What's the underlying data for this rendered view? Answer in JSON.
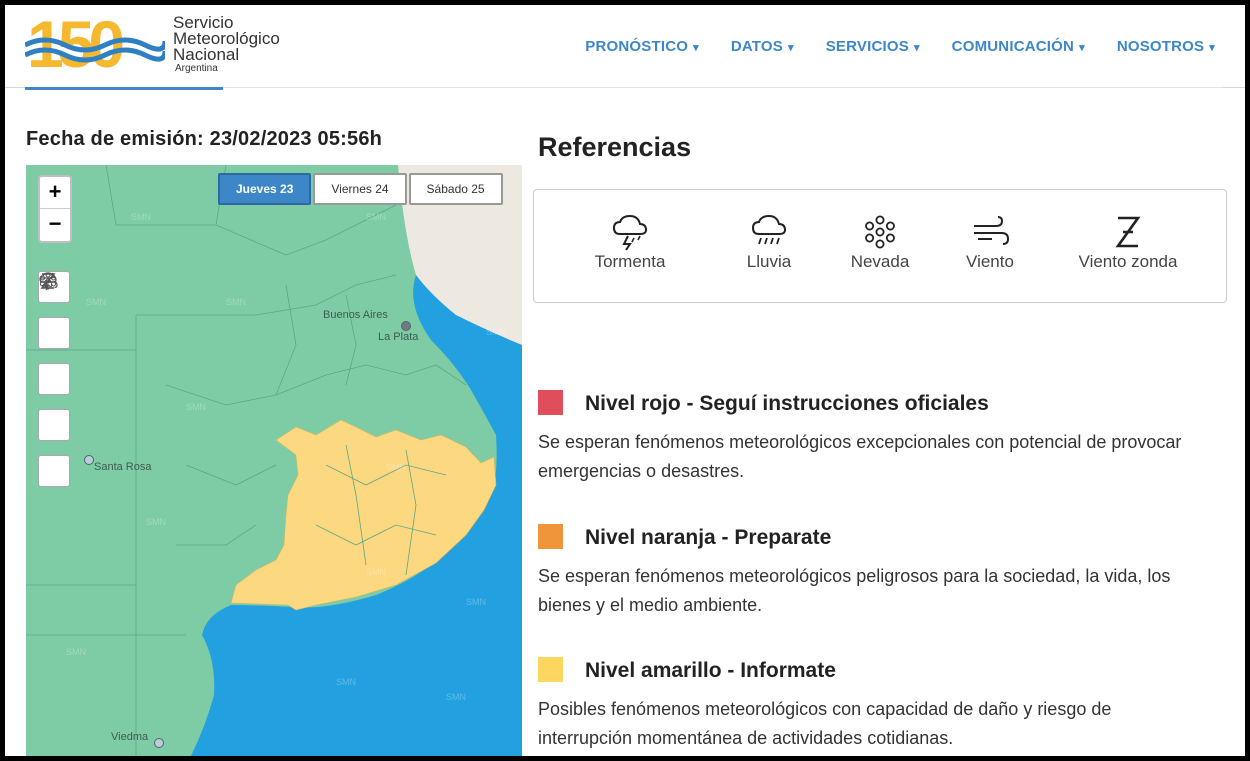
{
  "header": {
    "logo": {
      "number": "150",
      "line1": "Servicio",
      "line2": "Meteorológico",
      "line3": "Nacional",
      "line4": "Argentina"
    },
    "nav": [
      {
        "label": "PRONÓSTICO"
      },
      {
        "label": "DATOS"
      },
      {
        "label": "SERVICIOS"
      },
      {
        "label": "COMUNICACIÓN"
      },
      {
        "label": "NOSOTROS"
      }
    ],
    "colors": {
      "accent": "#3d87c9"
    }
  },
  "left": {
    "emision_label": "Fecha de emisión: 23/02/2023 05:56h",
    "map": {
      "zoom_in": "+",
      "zoom_out": "−",
      "day_tabs": [
        {
          "label": "Jueves 23",
          "active": true
        },
        {
          "label": "Viernes 24",
          "active": false
        },
        {
          "label": "Sábado 25",
          "active": false
        }
      ],
      "tools": [
        "storm-icon",
        "rain-icon",
        "snow-icon",
        "wind-icon",
        "zonda-icon"
      ],
      "cities": [
        {
          "name": "Buenos Aires"
        },
        {
          "name": "La Plata"
        },
        {
          "name": "Santa Rosa"
        },
        {
          "name": "Viedma"
        }
      ],
      "watermark": "SMN",
      "colors": {
        "land": "#7dcca5",
        "sea": "#22a0e0",
        "yellow_alert": "#fcd880",
        "neighbor": "#ede9e0"
      }
    }
  },
  "right": {
    "title": "Referencias",
    "references": [
      {
        "label": "Tormenta",
        "icon": "storm-icon"
      },
      {
        "label": "Lluvia",
        "icon": "rain-icon"
      },
      {
        "label": "Nevada",
        "icon": "snow-icon"
      },
      {
        "label": "Viento",
        "icon": "wind-icon"
      },
      {
        "label": "Viento zonda",
        "icon": "zonda-icon"
      }
    ],
    "levels": [
      {
        "color": "#e04d5b",
        "title": "Nivel rojo - Seguí instrucciones oficiales",
        "desc": "Se esperan fenómenos meteorológicos excepcionales con potencial de provocar emergencias o desastres."
      },
      {
        "color": "#f0953a",
        "title": "Nivel naranja - Preparate",
        "desc": "Se esperan fenómenos meteorológicos peligrosos para la sociedad, la vida, los bienes y el medio ambiente."
      },
      {
        "color": "#fcd65e",
        "title": "Nivel amarillo - Informate",
        "desc": "Posibles fenómenos meteorológicos con capacidad de daño y riesgo de interrupción momentánea de actividades cotidianas."
      }
    ]
  }
}
